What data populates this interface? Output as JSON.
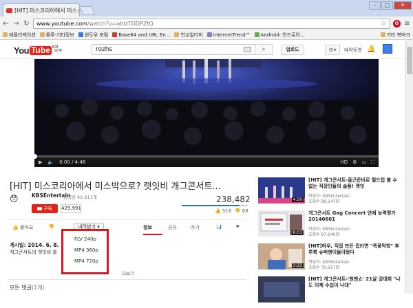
{
  "browser": {
    "tab_title": "[HIT] 미스코리아에서 미스",
    "tab_close": "×",
    "url_host": "www.youtube.com",
    "url_path": "/watch?v=oblzTDDPZtQ",
    "bookmarks": [
      {
        "label": "애플리케이션",
        "icon": "apps-icon"
      },
      {
        "label": "롤루-기타정보",
        "icon": "folder-icon"
      },
      {
        "label": "윈도우 포럼",
        "icon": "page-icon"
      },
      {
        "label": "Base64 and URL En...",
        "icon": "page-icon"
      },
      {
        "label": "학교알리미",
        "icon": "page-icon"
      },
      {
        "label": "InternetTrend™",
        "icon": "page-icon"
      },
      {
        "label": "Android: 안드로이...",
        "icon": "android-icon"
      }
    ],
    "bookmarks_other": "기타 북마크"
  },
  "header": {
    "logo_you": "You",
    "logo_tube": "Tube",
    "logo_region": "KR",
    "search_query": "rozhs",
    "upload_label": "업로드",
    "subscriptions_label": "예약동영",
    "colors": {
      "brand": "#e62117",
      "link": "#167ac6"
    }
  },
  "player": {
    "time_current": "0:00",
    "time_total": "4:48",
    "progress_fraction": 0.0,
    "time_sep": " / ",
    "hd_label": "HD"
  },
  "video": {
    "title": "[HIT] 미스코리아에서 미스박으로? 렛잇비 개그콘서트...",
    "channel": "KBSEntertain",
    "channel_videos": "동영상 42,611개",
    "subscribe_label": "구독",
    "subscriber_count": "425,991",
    "view_count": "238,482",
    "like_count": "516",
    "dislike_count": "68",
    "like_fraction": 0.88
  },
  "actions": {
    "like_label": "좋아요",
    "download_label": "내려받기",
    "tabs": [
      "정보",
      "공유",
      "추가"
    ]
  },
  "download_menu": {
    "options": [
      "FLV 240p",
      "MP4 360p",
      "MP4 720p"
    ]
  },
  "description": {
    "published": "게시일: 2014. 6. 8.",
    "text": "개그콘서트의 렛잇비 를",
    "more_label": "더보기"
  },
  "comments": {
    "label": "모든 댓글",
    "count": "(1개)"
  },
  "sidebar": {
    "items": [
      {
        "title": "[HIT] 개그콘서트-출근준비로 릴드컵 볼 수 없는 직장인들의 슬픔! 렛잇",
        "author": "작성자: KBSEntertain",
        "views": "조회수 89,147회",
        "duration": "4:59"
      },
      {
        "title": "개그콘서트 Gag Concert 연애 능력평가 20140601",
        "author": "작성자: KBSEntertain",
        "views": "조회수 87,640회",
        "duration": "8:03"
      },
      {
        "title": "[HIT]하우, 직접 만든 컵라면 \"폭풍먹방\" 후루룩 슈퍼맨이돌아왔다",
        "author": "작성자: KBSEntertain",
        "views": "조회수 70,917회",
        "duration": "3:22"
      },
      {
        "title": "[HIT] 개그콘서트-'원맨쇼' 21살 강대희 \"나도 이제 수업이 나대\"",
        "author": "작성자: KBSEntertain",
        "views": "",
        "duration": ""
      }
    ]
  }
}
